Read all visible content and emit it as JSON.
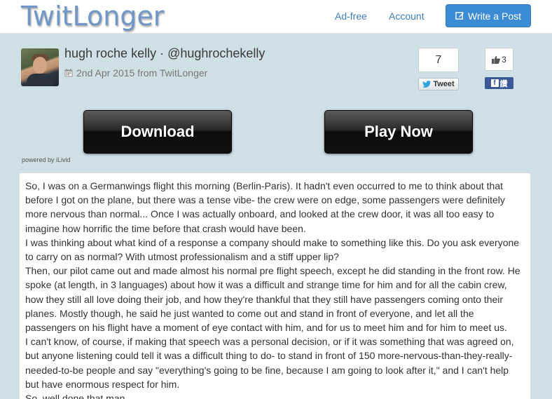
{
  "nav": {
    "logo": "TwitLonger",
    "adfree": "Ad-free",
    "account": "Account",
    "write_post": "Write a Post",
    "write_icon": "edit-icon"
  },
  "post_header": {
    "author": "hugh roche kelly · @hughrochekelly",
    "date_meta": "2nd Apr 2015 from TwitLonger",
    "calendar_icon": "calendar-icon"
  },
  "social": {
    "tweet_count": "7",
    "tweet_label": "Tweet",
    "like_count": "3",
    "share_label": "讚"
  },
  "ads": {
    "download_label": "Download",
    "play_label": "Play Now",
    "powered_by": "powered by iLivid"
  },
  "body": {
    "paragraphs": [
      "So, I was on a Germanwings flight this morning (Berlin-Paris). It hadn't even occurred to me to think about that before I got on the plane, but there was a tense vibe- the crew were on edge, some passengers were definitely more nervous than normal... Once I was actually onboard, and looked at the crew door, it was all too easy to imagine how horrific the time before that crash would have been.",
      "I was thinking about what kind of a response a company should make to something like this. Do you ask everyone to carry on as normal? With utmost professionalism and a stiff upper lip?",
      "Then, our pilot came out and made almost his normal pre flight speech, except he did standing in the front row. He spoke (at length, in 3 languages) about how it was a difficult and strange time for him and for all the cabin crew, how they still all love doing their job, and how they're thankful that they still have passengers coming onto their planes. Mostly though, he said he just wanted to come out and stand in front of everyone, and let all the passengers on his flight have a moment of eye contact with him, and for us to meet him and for him to meet us.",
      "I can't know, of course, if making that speech was a personal decision, or if it was something that was agreed on, but anyone listening could tell it was a difficult thing to do- to stand in front of 150 more-nervous-than-they-really-needed-to-be people and say \"everything's going to be fine, because I am going to look after it,\" and I can't help but have enormous respect for him.",
      "So, well done that man."
    ]
  },
  "colors": {
    "page_bg": "#cfe0e6",
    "link": "#3b80c0",
    "primary_button": "#3b8cd4",
    "facebook": "#3b5998"
  }
}
